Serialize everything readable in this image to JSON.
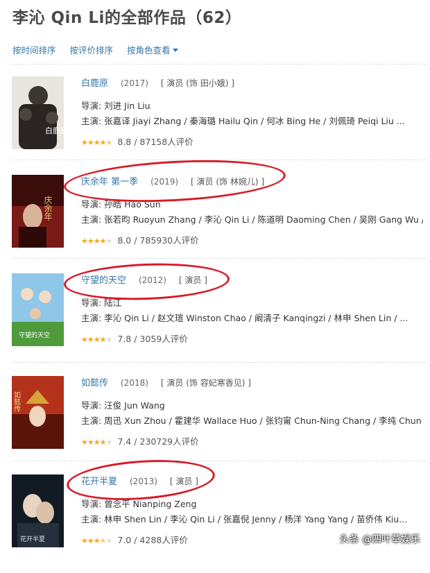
{
  "page": {
    "title": "李沁 Qin Li的全部作品（62）"
  },
  "sort": {
    "by_time": "按时间排序",
    "by_rating": "按评价排序",
    "by_role": "按角色查看"
  },
  "items": [
    {
      "title": "白鹿原",
      "year": "(2017)",
      "role": "[ 演员 (饰 田小娥) ]",
      "director": "导演: 刘进 Jin Liu",
      "cast": "主演: 张嘉译 Jiayi Zhang / 秦海璐 Hailu Qin / 何冰 Bing He / 刘佩琦 Peiqi Liu ...",
      "rating": "8.8 / 87158人评价",
      "stars": 4.5,
      "poster_text": "白鹿原"
    },
    {
      "title": "庆余年 第一季",
      "year": "(2019)",
      "role": "[ 演员 (饰 林婉儿) ]",
      "director": "导演: 孙皓 Hao Sun",
      "cast": "主演: 张若昀 Ruoyun Zhang / 李沁 Qin Li / 陈道明 Daoming Chen / 吴刚 Gang Wu /...",
      "rating": "8.0 / 785930人评价",
      "stars": 4,
      "poster_text": "庆余年"
    },
    {
      "title": "守望的天空",
      "year": "(2012)",
      "role": "[ 演员 ]",
      "director": "导演: 陆江",
      "cast": "主演: 李沁 Qin Li / 赵文瑄 Winston Chao / 阚清子 Kanqingzi / 林申 Shen Lin / ...",
      "rating": "7.8 / 3059人评价",
      "stars": 4,
      "poster_text": "守望的天空"
    },
    {
      "title": "如懿传",
      "year": "(2018)",
      "role": "[ 演员 (饰 容妃寒香见) ]",
      "director": "导演: 汪俊 Jun Wang",
      "cast": "主演: 周迅 Xun Zhou / 霍建华 Wallace Huo / 张钧甯 Chun-Ning Chang / 李纯 Chun ...",
      "rating": "7.4 / 230729人评价",
      "stars": 4,
      "poster_text": "如懿传"
    },
    {
      "title": "花开半夏",
      "year": "(2013)",
      "role": "[ 演员 ]",
      "director": "导演: 曾念平 Nianping Zeng",
      "cast": "主演: 林申 Shen Lin / 李沁 Qin Li / 张嘉倪 Jenny / 杨洋 Yang Yang / 苗侨伟 Kiu...",
      "rating": "7.0 / 4288人评价",
      "stars": 3.5,
      "poster_text": "花开半夏"
    }
  ],
  "watermark": "头条 @四叶草娱乐",
  "colors": {
    "link": "#3377aa",
    "star": "#f5a623",
    "annotation": "#d81a28"
  }
}
